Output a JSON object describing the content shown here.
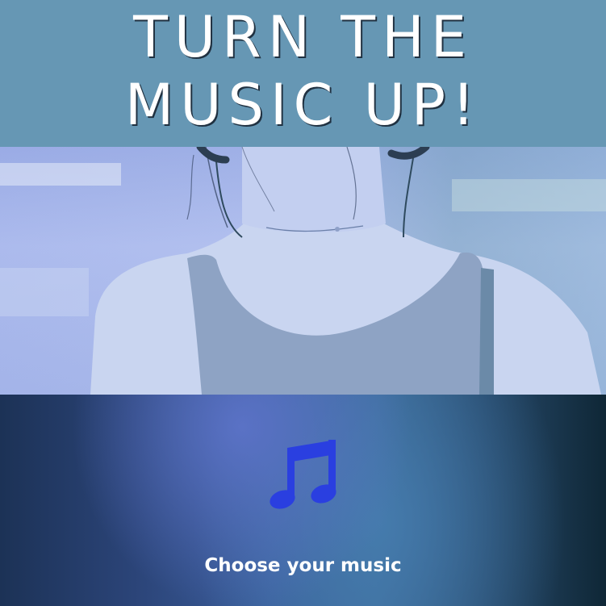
{
  "header": {
    "headline_line1": "TURN THE",
    "headline_line2": "MUSIC UP!"
  },
  "hero": {
    "image_subject": "woman-with-headphones-photo"
  },
  "cta": {
    "icon": "music-note-icon",
    "label": "Choose your music"
  },
  "colors": {
    "header_bg": "#6697b4",
    "headline_text": "#ffffff",
    "icon_color": "#2a3fe0",
    "label_text": "#ffffff",
    "bottom_dark": "#1c3256",
    "bottom_mid": "#3b5e9c"
  }
}
